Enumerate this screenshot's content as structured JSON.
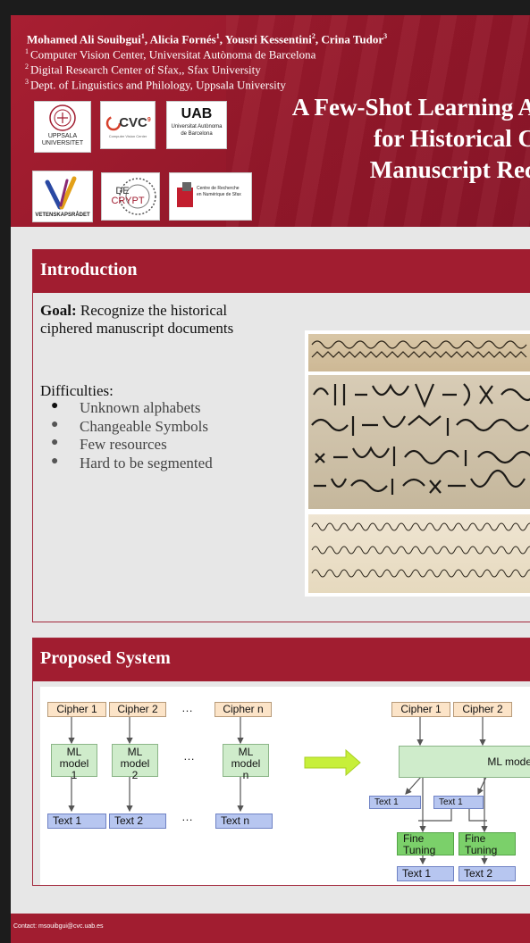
{
  "header": {
    "authors": [
      {
        "name": "Mohamed Ali Souibgui",
        "sup": "1",
        "sep": ", "
      },
      {
        "name": "Alicia Fornés",
        "sup": "1",
        "sep": ", "
      },
      {
        "name": "Yousri Kessentini",
        "sup": "2",
        "sep": ", "
      },
      {
        "name": "Crina Tudor",
        "sup": "3",
        "sep": ""
      }
    ],
    "affiliations": [
      {
        "sup": "1",
        "text": "Computer Vision Center, Universitat Autònoma de Barcelona"
      },
      {
        "sup": "2",
        "text": "Digital Research Center of Sfax,, Sfax University"
      },
      {
        "sup": "3",
        "text": "Dept. of Linguistics and Philology, Uppsala University"
      }
    ],
    "title_lines": [
      "A Few-Shot Learning A",
      "for Historical C",
      "Manuscript Rec"
    ]
  },
  "logos": {
    "uppsala_1": "UPPSALA",
    "uppsala_2": "UNIVERSITET",
    "cvc": "CVC",
    "cvc_sup": "9",
    "cvc_small": "Computer Vision Center",
    "uab": "UAB",
    "uab_1": "Universitat Autònoma",
    "uab_2": "de Barcelona",
    "vr": "VETENSKAPSRÅDET",
    "decrypt_1": "DE",
    "decrypt_2": "CRYPT",
    "crns_1": "Centre de Recherche",
    "crns_2": "en Numérique de Sfax"
  },
  "introduction": {
    "title": "Introduction",
    "goal_label": "Goal:",
    "goal_text_1": " Recognize the  historical",
    "goal_text_2": "ciphered manuscript documents",
    "difficulties_label": "Difficulties:",
    "difficulties": [
      "Unknown alphabets",
      "Changeable Symbols",
      "Few resources",
      "Hard to be segmented"
    ]
  },
  "proposed": {
    "title": "Proposed System",
    "left": {
      "ciphers": [
        "Cipher 1",
        "Cipher 2",
        "Cipher n"
      ],
      "models": [
        [
          "ML",
          "model",
          "1"
        ],
        [
          "ML",
          "model",
          "2"
        ],
        [
          "ML",
          "model",
          "n"
        ]
      ],
      "texts": [
        "Text 1",
        "Text 2",
        "Text n"
      ],
      "dots": "…"
    },
    "right": {
      "ciphers": [
        "Cipher 1",
        "Cipher 2"
      ],
      "model": "ML mode",
      "mid_texts": [
        "Text 1",
        "Text 1"
      ],
      "fine_tuning": [
        [
          "Fine",
          "Tuning"
        ],
        [
          "Fine",
          "Tuning"
        ]
      ],
      "texts": [
        "Text 1",
        "Text 2"
      ]
    },
    "colors": {
      "cipher": "#fce4c8",
      "model": "#cfeccb",
      "text": "#b7c6f0",
      "fine_tuning": "#7bd06a",
      "arrow": "#c7ef3a"
    }
  },
  "footer": {
    "contact": "Contact: msouibgui@cvc.uab.es"
  },
  "colors": {
    "accent": "#a11d30",
    "background": "#e7e7e7"
  }
}
